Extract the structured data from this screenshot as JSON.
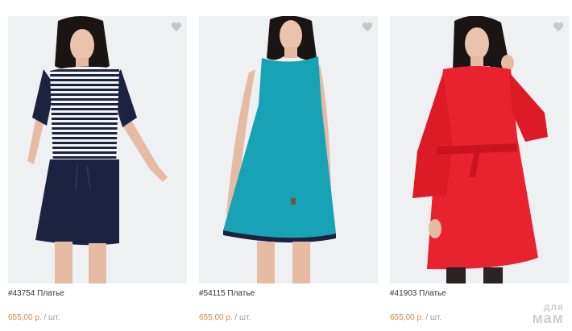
{
  "products": [
    {
      "title": "#43754 Платье",
      "price": "655,00 р.",
      "unit": " / шт.",
      "favorite_icon": "heart-icon",
      "dress_color": "#1c2340"
    },
    {
      "title": "#54115 Платье",
      "price": "655,00 р.",
      "unit": " / шт.",
      "favorite_icon": "heart-icon",
      "dress_color": "#17a3b5"
    },
    {
      "title": "#41903 Платье",
      "price": "655,00 р.",
      "unit": " / шт.",
      "favorite_icon": "heart-icon",
      "dress_color": "#e8222e"
    }
  ],
  "watermark": {
    "line1": "для",
    "line2": "мам"
  }
}
